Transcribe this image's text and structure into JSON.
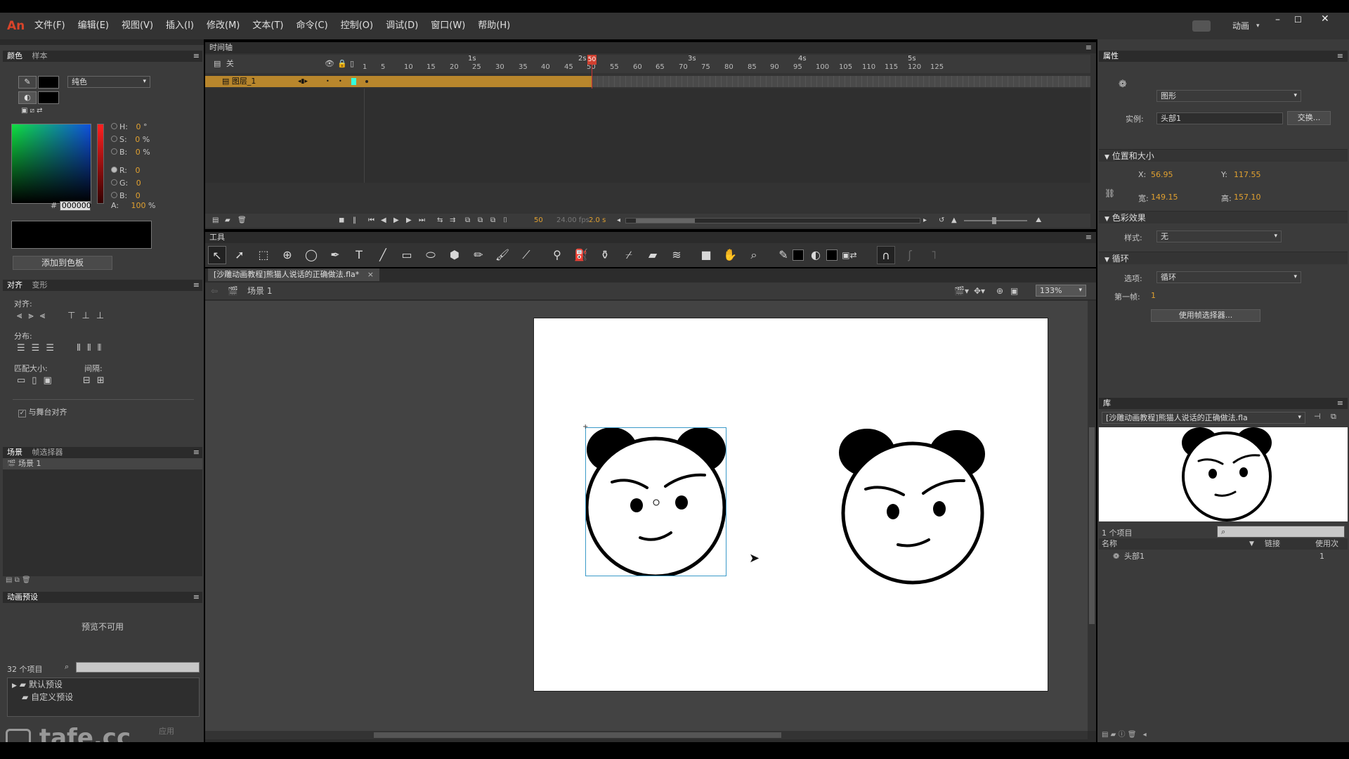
{
  "app": {
    "logo": "An",
    "menu": [
      "文件(F)",
      "编辑(E)",
      "视图(V)",
      "插入(I)",
      "修改(M)",
      "文本(T)",
      "命令(C)",
      "控制(O)",
      "调试(D)",
      "窗口(W)",
      "帮助(H)"
    ],
    "workspace": "动画",
    "watermark": "tafe.cc"
  },
  "color_panel": {
    "tabs": [
      "颜色",
      "样本"
    ],
    "fill_type": "纯色",
    "hsb": [
      {
        "label": "H:",
        "value": "0",
        "unit": "°"
      },
      {
        "label": "S:",
        "value": "0",
        "unit": "%"
      },
      {
        "label": "B:",
        "value": "0",
        "unit": "%"
      }
    ],
    "rgb": [
      {
        "label": "R:",
        "value": "0"
      },
      {
        "label": "G:",
        "value": "0"
      },
      {
        "label": "B:",
        "value": "0"
      }
    ],
    "alpha_label": "A:",
    "alpha_value": "100",
    "alpha_unit": "%",
    "hex_prefix": "#",
    "hex": "000000",
    "add_swatch": "添加到色板"
  },
  "align_panel": {
    "tabs": [
      "对齐",
      "变形"
    ],
    "align_label": "对齐:",
    "distribute_label": "分布:",
    "match_size_label": "匹配大小:",
    "spacing_label": "间隔:",
    "stage_align": "与舞台对齐"
  },
  "scene_panel": {
    "tabs": [
      "场景",
      "帧选择器"
    ],
    "scenes": [
      "场景 1"
    ]
  },
  "motion_presets": {
    "title": "动画预设",
    "preview": "预览不可用",
    "count": "32 个项目",
    "folders": [
      "默认预设",
      "自定义预设"
    ],
    "apply": "应用"
  },
  "timeline": {
    "title": "时间轴",
    "layer_header": "关",
    "layers": [
      {
        "name": "图层_1"
      }
    ],
    "second_marks": [
      "1s",
      "2s",
      "3s",
      "4s",
      "5s"
    ],
    "frame_numbers": [
      "1",
      "5",
      "10",
      "15",
      "20",
      "25",
      "30",
      "35",
      "40",
      "45",
      "50",
      "55",
      "60",
      "65",
      "70",
      "75",
      "80",
      "85",
      "90",
      "95",
      "100",
      "105",
      "110",
      "115",
      "120",
      "125"
    ],
    "current_frame": "50",
    "fps": "24.00 fps",
    "time": "2.0 s"
  },
  "tools": {
    "title": "工具"
  },
  "document": {
    "tab": "[沙雕动画教程]熊猫人说话的正确做法.fla*",
    "scene": "场景 1",
    "zoom": "133%"
  },
  "properties": {
    "title": "属性",
    "instance_type": "图形",
    "instance_label": "实例:",
    "instance_name": "头部1",
    "swap": "交换...",
    "pos_section": "位置和大小",
    "x_label": "X:",
    "x": "56.95",
    "y_label": "Y:",
    "y": "117.55",
    "w_label": "宽:",
    "w": "149.15",
    "h_label": "高:",
    "h": "157.10",
    "color_section": "色彩效果",
    "style_label": "样式:",
    "style": "无",
    "loop_section": "循环",
    "option_label": "选项:",
    "option": "循环",
    "first_frame_label": "第一帧:",
    "first_frame": "1",
    "frame_picker": "使用帧选择器..."
  },
  "library": {
    "title": "库",
    "file": "[沙雕动画教程]熊猫人说话的正确做法.fla",
    "count": "1 个项目",
    "col_name": "名称",
    "col_link": "链接",
    "col_use": "使用次",
    "items": [
      {
        "name": "头部1",
        "uses": "1"
      }
    ]
  }
}
